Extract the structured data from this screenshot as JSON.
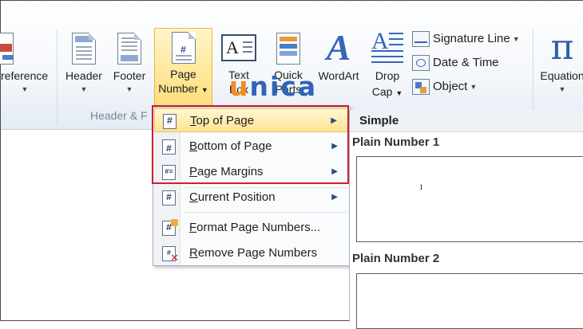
{
  "ribbon": {
    "reference_label": "reference",
    "header_label": "Header",
    "footer_label": "Footer",
    "page_number_label_1": "Page",
    "page_number_label_2": "Number",
    "text_box_label_1": "Text",
    "text_box_label_2": "Box",
    "quick_parts_label_1": "Quick",
    "quick_parts_label_2": "Parts",
    "wordart_label": "WordArt",
    "drop_cap_label_1": "Drop",
    "drop_cap_label_2": "Cap",
    "signature_line_label": "Signature Line",
    "date_time_label": "Date & Time",
    "object_label": "Object",
    "equation_label": "Equation",
    "equation_symbol": "π",
    "group_header_footer": "Header & F"
  },
  "watermark": {
    "part1": "u",
    "part2": "nica"
  },
  "menu": {
    "items": [
      {
        "label": "Top of Page",
        "underline": "T",
        "rest": "op of Page",
        "submenu": true,
        "highlighted": true,
        "icon": "page-number-icon"
      },
      {
        "label": "Bottom of Page",
        "underline": "B",
        "rest": "ottom of Page",
        "submenu": true,
        "highlighted": false,
        "icon": "page-number-bottom-icon"
      },
      {
        "label": "Page Margins",
        "underline": "P",
        "rest": "age Margins",
        "submenu": true,
        "highlighted": false,
        "icon": "page-margins-icon"
      },
      {
        "label": "Current Position",
        "underline": "C",
        "rest": "urrent Position",
        "submenu": true,
        "highlighted": false,
        "icon": "current-position-icon"
      },
      {
        "label": "Format Page Numbers...",
        "underline": "F",
        "rest": "ormat Page Numbers...",
        "submenu": false,
        "highlighted": false,
        "icon": "format-page-numbers-icon"
      },
      {
        "label": "Remove Page Numbers",
        "underline": "R",
        "rest": "emove Page Numbers",
        "submenu": false,
        "highlighted": false,
        "icon": "remove-page-numbers-icon"
      }
    ]
  },
  "gallery": {
    "section_title": "Simple",
    "items": [
      {
        "name": "Plain Number 1",
        "preview_number": "1"
      },
      {
        "name": "Plain Number 2"
      }
    ]
  },
  "colors": {
    "highlight": "#ffe393",
    "callout_border": "#d0202e",
    "watermark_blue": "#2e64b7",
    "watermark_orange": "#f28c1e"
  }
}
